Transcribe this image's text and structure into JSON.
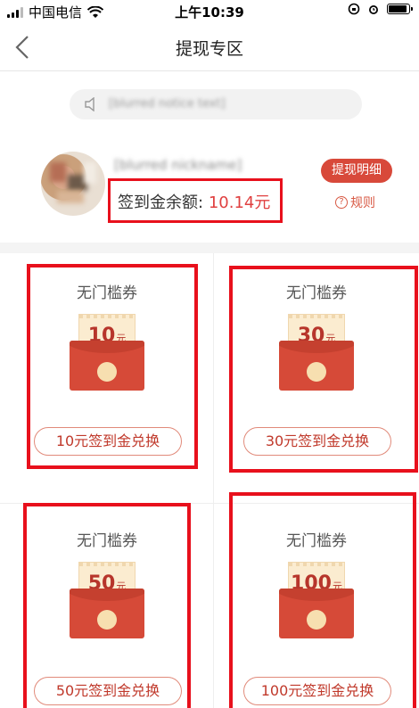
{
  "status_bar": {
    "carrier": "中国电信",
    "time": "上午10:39"
  },
  "nav": {
    "title": "提现专区",
    "back_icon": "chevron-left-icon"
  },
  "notice": {
    "text": "[blurred notice text]"
  },
  "profile": {
    "nickname": "[blurred nickname]",
    "balance_label": "签到金余额:",
    "balance_value": "10.14元",
    "detail_button": "提现明细",
    "rules_label": "规则"
  },
  "coupons": [
    {
      "title": "无门槛券",
      "amount": "10",
      "unit": "元",
      "button": "10元签到金兑换"
    },
    {
      "title": "无门槛券",
      "amount": "30",
      "unit": "元",
      "button": "30元签到金兑换"
    },
    {
      "title": "无门槛券",
      "amount": "50",
      "unit": "元",
      "button": "50元签到金兑换"
    },
    {
      "title": "无门槛券",
      "amount": "100",
      "unit": "元",
      "button": "100元签到金兑换"
    }
  ],
  "colors": {
    "accent": "#d8493a",
    "highlight": "#e8101c",
    "envelope": "#d64a38"
  }
}
